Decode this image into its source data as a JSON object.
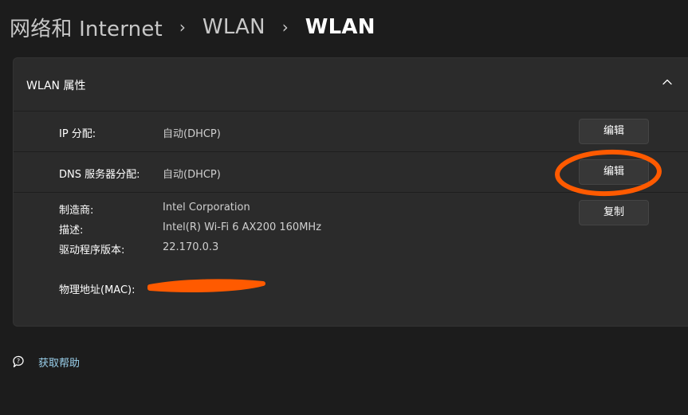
{
  "breadcrumb": {
    "items": [
      "网络和 Internet",
      "WLAN",
      "WLAN"
    ],
    "separator": "›"
  },
  "card": {
    "title": "WLAN 属性",
    "rows": [
      {
        "label": "IP 分配:",
        "value": "自动(DHCP)",
        "button": "编辑"
      },
      {
        "label": "DNS 服务器分配:",
        "value": "自动(DHCP)",
        "button": "编辑"
      }
    ],
    "info": {
      "manufacturer_label": "制造商:",
      "manufacturer": "Intel Corporation",
      "description_label": "描述:",
      "description": "Intel(R) Wi-Fi 6 AX200 160MHz",
      "driver_label": "驱动程序版本:",
      "driver": "22.170.0.3",
      "mac_label": "物理地址(MAC):",
      "copy_button": "复制"
    }
  },
  "help": {
    "label": "获取帮助"
  },
  "colors": {
    "background": "#1c1c1c",
    "card": "#2b2b2b",
    "link": "#9ad0ec",
    "annotation": "#ff5a00"
  },
  "icons": {
    "collapse": "chevron-up-icon",
    "help": "help-chat-icon"
  }
}
